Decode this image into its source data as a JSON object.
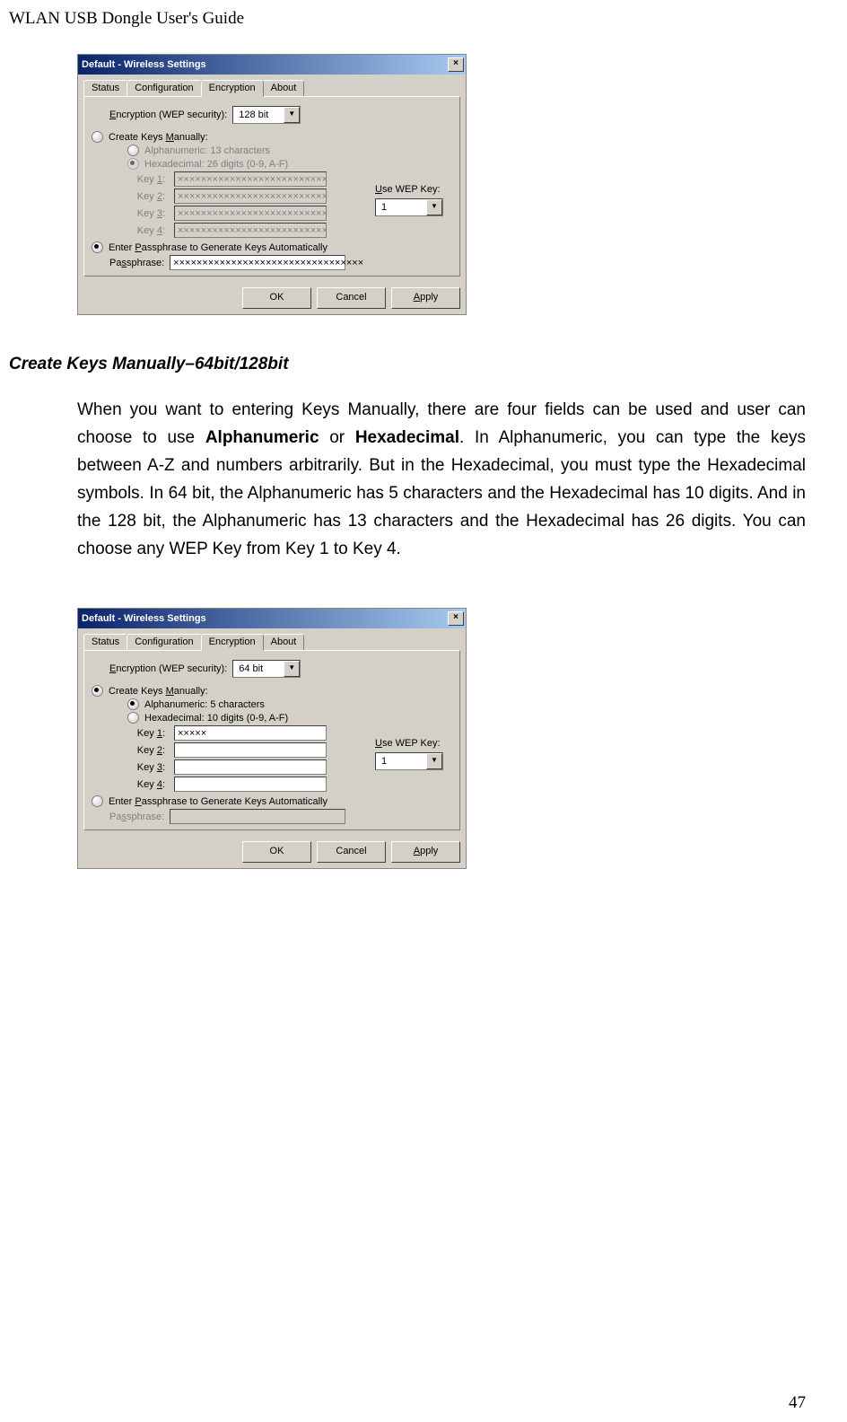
{
  "header": "WLAN USB Dongle User's Guide",
  "win1": {
    "title": "Default - Wireless Settings",
    "tabs": [
      "Status",
      "Configuration",
      "Encryption",
      "About"
    ],
    "encLabel": "Encryption (WEP security):",
    "encValue": "128 bit",
    "createManual": "Create Keys Manually:",
    "alpha": "Alphanumeric: 13 characters",
    "hex": "Hexadecimal: 26 digits (0-9, A-F)",
    "key1l": "Key 1:",
    "key2l": "Key 2:",
    "key3l": "Key 3:",
    "key4l": "Key 4:",
    "keyval": "××××××××××××××××××××××××××",
    "useWep": "Use WEP Key:",
    "useWepVal": "1",
    "enterPass": "Enter Passphrase to Generate Keys Automatically",
    "passL": "Passphrase:",
    "passV": "×××××××××××××××××××××××××××××××××",
    "ok": "OK",
    "cancel": "Cancel",
    "apply": "Apply"
  },
  "sectionHeading": "Create Keys Manually–64bit/128bit",
  "bodyText": "When you want to entering Keys Manually, there are four fields can be used and user can choose to use <b>Alphanumeric</b> or <b>Hexadecimal</b>. In Alphanumeric, you can type the keys between A-Z and numbers arbitrarily. But in the Hexadecimal, you must type the Hexadecimal symbols. In 64 bit, the Alphanumeric has 5 characters and the Hexadecimal has 10 digits. And in the 128 bit, the Alphanumeric has 13 characters and the Hexadecimal has 26 digits. You can choose any WEP Key from Key 1 to Key 4.",
  "win2": {
    "title": "Default - Wireless Settings",
    "encValue": "64 bit",
    "alpha": "Alphanumeric: 5 characters",
    "hex": "Hexadecimal: 10 digits (0-9, A-F)",
    "key1v": "×××××",
    "passL": "Passphrase:"
  },
  "pageNumber": "47"
}
